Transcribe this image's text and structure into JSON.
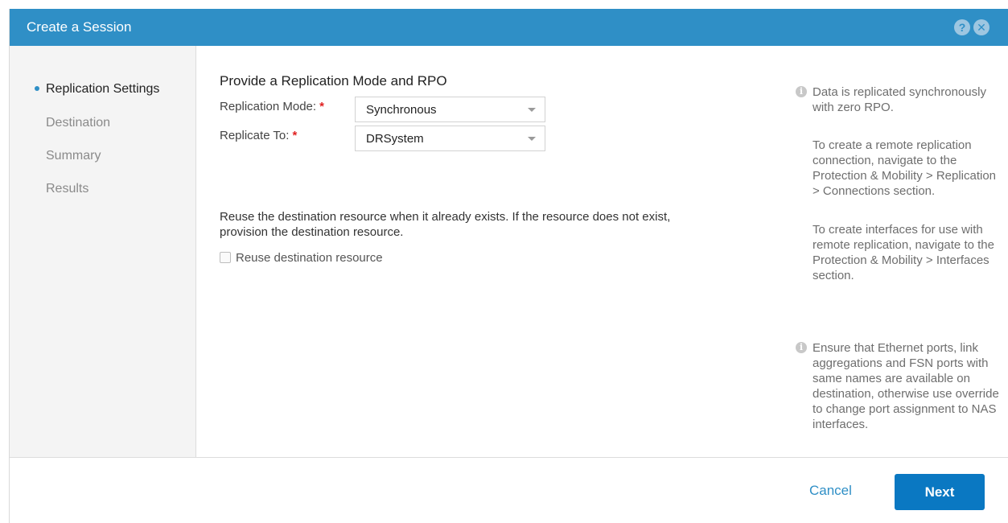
{
  "dialog": {
    "title": "Create a Session",
    "help_icon_glyph": "?",
    "close_icon_glyph": "✕",
    "accent_color": "#2f8fc6"
  },
  "steps": [
    {
      "label": "Replication Settings",
      "active": true
    },
    {
      "label": "Destination",
      "active": false
    },
    {
      "label": "Summary",
      "active": false
    },
    {
      "label": "Results",
      "active": false
    }
  ],
  "main": {
    "section_title": "Provide a Replication Mode and RPO",
    "replication_mode": {
      "label": "Replication Mode:",
      "required_marker": "*",
      "value": "Synchronous"
    },
    "replicate_to": {
      "label": "Replicate To:",
      "required_marker": "*",
      "value": "DRSystem"
    },
    "reuse_description": "Reuse the destination resource when it already exists. If the resource does not exist, provision the destination resource.",
    "reuse_checkbox": {
      "label": "Reuse destination resource",
      "checked": false
    }
  },
  "info": {
    "icon_glyph": "i",
    "block1": [
      "Data is replicated synchronously with zero RPO.",
      "To create a remote replication connection, navigate to the Protection & Mobility > Replication > Connections section.",
      "To create interfaces for use with remote replication, navigate to the Protection & Mobility > Interfaces section."
    ],
    "block2": "Ensure that Ethernet ports, link aggregations and FSN ports with same names are available on destination, otherwise use override to change port assignment to NAS interfaces."
  },
  "footer": {
    "cancel_label": "Cancel",
    "next_label": "Next"
  }
}
